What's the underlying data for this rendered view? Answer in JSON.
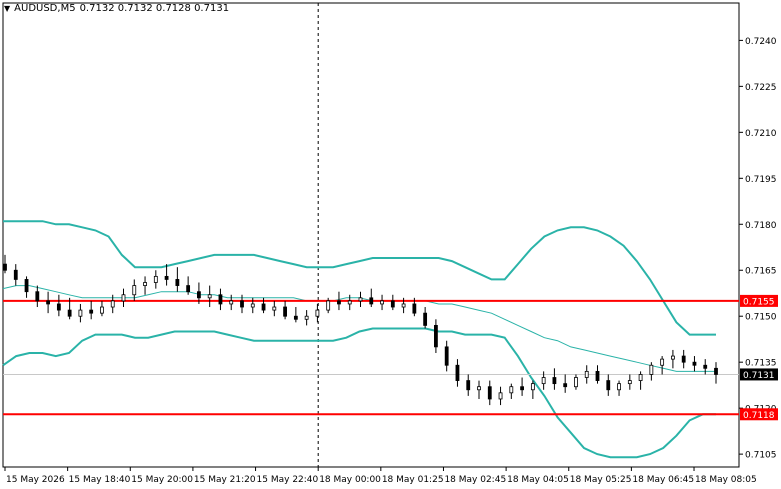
{
  "header": {
    "symbol": "AUDUSD,M5",
    "ohlc": "0.7132 0.7132 0.7128 0.7131",
    "menu_icon": "triangle-down-icon"
  },
  "colors": {
    "band": "#2ab3a8",
    "level": "#ff0000",
    "candle": "#000000",
    "grid": "#c8c8c8",
    "price_label_bg": "#000000",
    "level_label_bg": "#ff0000"
  },
  "chart_data": {
    "type": "candlestick",
    "symbol": "AUDUSD",
    "timeframe": "M5",
    "y_ticks": [
      "0.7240",
      "0.7225",
      "0.7210",
      "0.7195",
      "0.7180",
      "0.7165",
      "0.7150",
      "0.7135",
      "0.7120",
      "0.7105"
    ],
    "ylim": [
      0.71008,
      0.72522
    ],
    "x_tick_labels": [
      "15 May 2026",
      "15 May 18:40",
      "15 May 20:00",
      "15 May 21:20",
      "15 May 22:40",
      "18 May 00:00",
      "18 May 01:25",
      "18 May 02:45",
      "18 May 04:05",
      "18 May 05:25",
      "18 May 06:45",
      "18 May 08:05"
    ],
    "current_price": "0.7131",
    "horizontal_levels": [
      {
        "label": "0.7155",
        "value": 0.7155
      },
      {
        "label": "0.7118",
        "value": 0.7118
      }
    ],
    "period_separator_label": "18 May 00:00",
    "bollinger_upper": [
      0.7181,
      0.7181,
      0.7181,
      0.7181,
      0.718,
      0.718,
      0.7179,
      0.7178,
      0.7176,
      0.717,
      0.7166,
      0.7166,
      0.7166,
      0.7167,
      0.7168,
      0.7169,
      0.717,
      0.717,
      0.717,
      0.717,
      0.7169,
      0.7168,
      0.7167,
      0.7166,
      0.7166,
      0.7166,
      0.7167,
      0.7168,
      0.7169,
      0.7169,
      0.7169,
      0.7169,
      0.7169,
      0.7169,
      0.7168,
      0.7166,
      0.7164,
      0.7162,
      0.7162,
      0.7167,
      0.7172,
      0.7176,
      0.7178,
      0.7179,
      0.7179,
      0.7178,
      0.7176,
      0.7173,
      0.7168,
      0.7162,
      0.7155,
      0.7148,
      0.7144,
      0.7144,
      0.7144
    ],
    "bollinger_middle": [
      0.7159,
      0.716,
      0.716,
      0.7159,
      0.7158,
      0.7157,
      0.7156,
      0.7156,
      0.7156,
      0.7156,
      0.7156,
      0.7157,
      0.7158,
      0.7158,
      0.7158,
      0.7157,
      0.7157,
      0.7156,
      0.7156,
      0.7156,
      0.7156,
      0.7156,
      0.7156,
      0.7155,
      0.7155,
      0.7155,
      0.7156,
      0.7156,
      0.7155,
      0.7155,
      0.7155,
      0.7155,
      0.7155,
      0.7154,
      0.7154,
      0.7153,
      0.7152,
      0.7151,
      0.7149,
      0.7147,
      0.7145,
      0.7143,
      0.7142,
      0.714,
      0.7139,
      0.7138,
      0.7137,
      0.7136,
      0.7135,
      0.7134,
      0.7133,
      0.7132,
      0.7132,
      0.7132,
      0.7132
    ],
    "bollinger_lower": [
      0.7134,
      0.7137,
      0.7138,
      0.7138,
      0.7137,
      0.7138,
      0.7142,
      0.7144,
      0.7144,
      0.7144,
      0.7143,
      0.7143,
      0.7144,
      0.7145,
      0.7145,
      0.7145,
      0.7145,
      0.7144,
      0.7143,
      0.7142,
      0.7142,
      0.7142,
      0.7142,
      0.7142,
      0.7142,
      0.7142,
      0.7143,
      0.7145,
      0.7146,
      0.7146,
      0.7146,
      0.7146,
      0.7146,
      0.7145,
      0.7145,
      0.7144,
      0.7144,
      0.7144,
      0.7143,
      0.7137,
      0.713,
      0.7124,
      0.7117,
      0.7112,
      0.7107,
      0.7105,
      0.7104,
      0.7104,
      0.7104,
      0.7105,
      0.7107,
      0.7111,
      0.7116,
      0.7118,
      0.7118
    ],
    "candles": [
      {
        "o": 0.7167,
        "h": 0.717,
        "l": 0.7164,
        "c": 0.7165
      },
      {
        "o": 0.7165,
        "h": 0.7167,
        "l": 0.716,
        "c": 0.7162
      },
      {
        "o": 0.7162,
        "h": 0.7163,
        "l": 0.7156,
        "c": 0.7158
      },
      {
        "o": 0.7158,
        "h": 0.716,
        "l": 0.7153,
        "c": 0.7155
      },
      {
        "o": 0.7155,
        "h": 0.7158,
        "l": 0.7151,
        "c": 0.7154
      },
      {
        "o": 0.7154,
        "h": 0.7157,
        "l": 0.715,
        "c": 0.7152
      },
      {
        "o": 0.7152,
        "h": 0.7156,
        "l": 0.7149,
        "c": 0.715
      },
      {
        "o": 0.715,
        "h": 0.7154,
        "l": 0.7148,
        "c": 0.7152
      },
      {
        "o": 0.7152,
        "h": 0.7155,
        "l": 0.7149,
        "c": 0.7151
      },
      {
        "o": 0.7151,
        "h": 0.7155,
        "l": 0.715,
        "c": 0.7153
      },
      {
        "o": 0.7153,
        "h": 0.7157,
        "l": 0.7151,
        "c": 0.7155
      },
      {
        "o": 0.7155,
        "h": 0.7159,
        "l": 0.7153,
        "c": 0.7157
      },
      {
        "o": 0.7157,
        "h": 0.7162,
        "l": 0.7155,
        "c": 0.716
      },
      {
        "o": 0.716,
        "h": 0.7163,
        "l": 0.7157,
        "c": 0.7161
      },
      {
        "o": 0.7161,
        "h": 0.7165,
        "l": 0.7159,
        "c": 0.7163
      },
      {
        "o": 0.7163,
        "h": 0.7167,
        "l": 0.716,
        "c": 0.7162
      },
      {
        "o": 0.7162,
        "h": 0.7166,
        "l": 0.7158,
        "c": 0.716
      },
      {
        "o": 0.716,
        "h": 0.7163,
        "l": 0.7157,
        "c": 0.7158
      },
      {
        "o": 0.7158,
        "h": 0.7161,
        "l": 0.7154,
        "c": 0.7156
      },
      {
        "o": 0.7156,
        "h": 0.716,
        "l": 0.7153,
        "c": 0.7157
      },
      {
        "o": 0.7157,
        "h": 0.7159,
        "l": 0.7152,
        "c": 0.7154
      },
      {
        "o": 0.7154,
        "h": 0.7157,
        "l": 0.7152,
        "c": 0.7155
      },
      {
        "o": 0.7155,
        "h": 0.7157,
        "l": 0.7151,
        "c": 0.7153
      },
      {
        "o": 0.7153,
        "h": 0.7156,
        "l": 0.7151,
        "c": 0.7154
      },
      {
        "o": 0.7154,
        "h": 0.7156,
        "l": 0.7151,
        "c": 0.7152
      },
      {
        "o": 0.7152,
        "h": 0.7155,
        "l": 0.715,
        "c": 0.7153
      },
      {
        "o": 0.7153,
        "h": 0.7155,
        "l": 0.7149,
        "c": 0.715
      },
      {
        "o": 0.715,
        "h": 0.7153,
        "l": 0.7148,
        "c": 0.7149
      },
      {
        "o": 0.7149,
        "h": 0.7152,
        "l": 0.7147,
        "c": 0.715
      },
      {
        "o": 0.715,
        "h": 0.7154,
        "l": 0.7148,
        "c": 0.7152
      },
      {
        "o": 0.7152,
        "h": 0.7156,
        "l": 0.7151,
        "c": 0.7155
      },
      {
        "o": 0.7155,
        "h": 0.7158,
        "l": 0.7152,
        "c": 0.7154
      },
      {
        "o": 0.7154,
        "h": 0.7157,
        "l": 0.7152,
        "c": 0.7155
      },
      {
        "o": 0.7155,
        "h": 0.7158,
        "l": 0.7153,
        "c": 0.7156
      },
      {
        "o": 0.7156,
        "h": 0.7159,
        "l": 0.7153,
        "c": 0.7154
      },
      {
        "o": 0.7154,
        "h": 0.7157,
        "l": 0.7152,
        "c": 0.7155
      },
      {
        "o": 0.7155,
        "h": 0.7157,
        "l": 0.7152,
        "c": 0.7153
      },
      {
        "o": 0.7153,
        "h": 0.7156,
        "l": 0.7151,
        "c": 0.7154
      },
      {
        "o": 0.7154,
        "h": 0.7156,
        "l": 0.715,
        "c": 0.7151
      },
      {
        "o": 0.7151,
        "h": 0.7153,
        "l": 0.7146,
        "c": 0.7147
      },
      {
        "o": 0.7147,
        "h": 0.7149,
        "l": 0.7138,
        "c": 0.714
      },
      {
        "o": 0.714,
        "h": 0.7142,
        "l": 0.7132,
        "c": 0.7134
      },
      {
        "o": 0.7134,
        "h": 0.7136,
        "l": 0.7127,
        "c": 0.7129
      },
      {
        "o": 0.7129,
        "h": 0.7131,
        "l": 0.7124,
        "c": 0.7126
      },
      {
        "o": 0.7126,
        "h": 0.7129,
        "l": 0.7123,
        "c": 0.7127
      },
      {
        "o": 0.7127,
        "h": 0.7129,
        "l": 0.7121,
        "c": 0.7123
      },
      {
        "o": 0.7123,
        "h": 0.7127,
        "l": 0.7121,
        "c": 0.7125
      },
      {
        "o": 0.7125,
        "h": 0.7128,
        "l": 0.7123,
        "c": 0.7127
      },
      {
        "o": 0.7127,
        "h": 0.713,
        "l": 0.7124,
        "c": 0.7126
      },
      {
        "o": 0.7126,
        "h": 0.7129,
        "l": 0.7123,
        "c": 0.7128
      },
      {
        "o": 0.7128,
        "h": 0.7132,
        "l": 0.7126,
        "c": 0.713
      },
      {
        "o": 0.713,
        "h": 0.7133,
        "l": 0.7126,
        "c": 0.7128
      },
      {
        "o": 0.7128,
        "h": 0.7131,
        "l": 0.7125,
        "c": 0.7127
      },
      {
        "o": 0.7127,
        "h": 0.7131,
        "l": 0.7126,
        "c": 0.713
      },
      {
        "o": 0.713,
        "h": 0.7134,
        "l": 0.7128,
        "c": 0.7132
      },
      {
        "o": 0.7132,
        "h": 0.7134,
        "l": 0.7128,
        "c": 0.7129
      },
      {
        "o": 0.7129,
        "h": 0.7131,
        "l": 0.7124,
        "c": 0.7126
      },
      {
        "o": 0.7126,
        "h": 0.7129,
        "l": 0.7124,
        "c": 0.7128
      },
      {
        "o": 0.7128,
        "h": 0.7131,
        "l": 0.7126,
        "c": 0.7129
      },
      {
        "o": 0.7129,
        "h": 0.7132,
        "l": 0.7126,
        "c": 0.7131
      },
      {
        "o": 0.7131,
        "h": 0.7135,
        "l": 0.7129,
        "c": 0.7134
      },
      {
        "o": 0.7134,
        "h": 0.7137,
        "l": 0.7131,
        "c": 0.7136
      },
      {
        "o": 0.7136,
        "h": 0.7139,
        "l": 0.7133,
        "c": 0.7137
      },
      {
        "o": 0.7137,
        "h": 0.7139,
        "l": 0.7133,
        "c": 0.7135
      },
      {
        "o": 0.7135,
        "h": 0.7137,
        "l": 0.7132,
        "c": 0.7134
      },
      {
        "o": 0.7134,
        "h": 0.7136,
        "l": 0.7131,
        "c": 0.7133
      },
      {
        "o": 0.7133,
        "h": 0.7135,
        "l": 0.7128,
        "c": 0.7131
      }
    ]
  }
}
